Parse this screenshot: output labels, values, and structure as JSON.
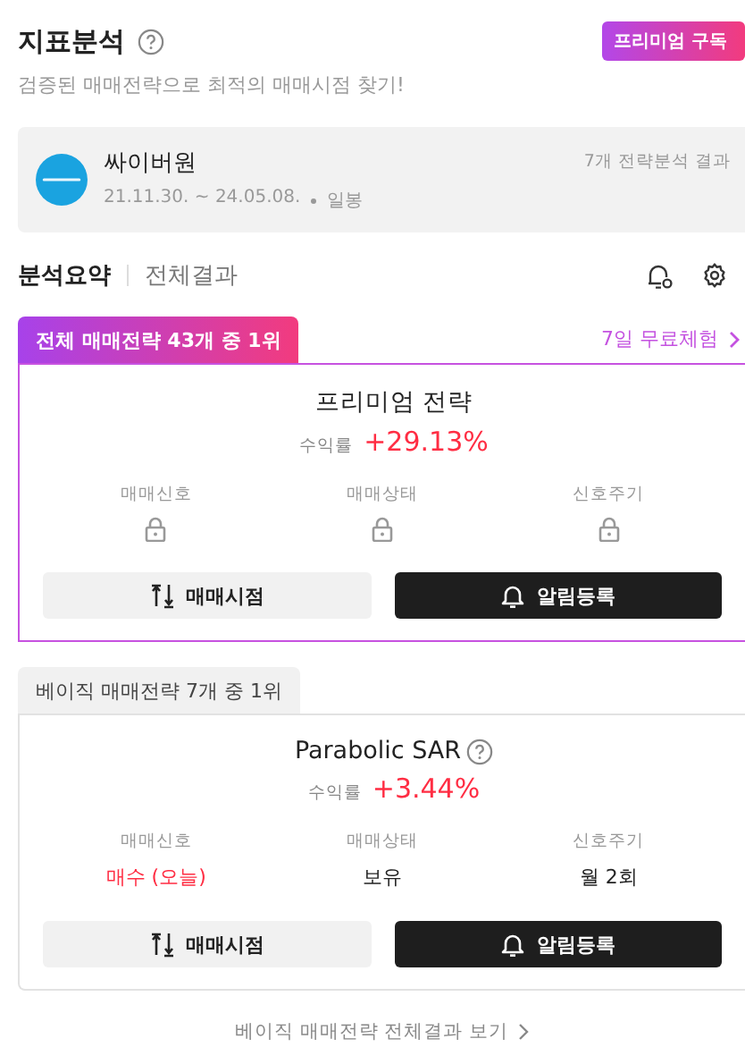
{
  "header": {
    "title": "지표분석",
    "subtitle": "검증된 매매전략으로 최적의 매매시점 찾기!",
    "premium_button": "프리미엄 구독"
  },
  "stock": {
    "name": "싸이버원",
    "period": "21.11.30. ~ 24.05.08.",
    "interval": "일봉",
    "result_count": "7개 전략분석 결과"
  },
  "tabs": [
    {
      "label": "분석요약",
      "selected": true
    },
    {
      "label": "전체결과",
      "selected": false
    }
  ],
  "strategies": [
    {
      "kind": "premium",
      "rank": "전체 매매전략 43개 중 1위",
      "trial_link": "7일 무료체험",
      "name": "프리미엄 전략",
      "help": false,
      "return_label": "수익률",
      "return_value": "+29.13%",
      "stats": [
        {
          "label": "매매신호",
          "locked": true
        },
        {
          "label": "매매상태",
          "locked": true
        },
        {
          "label": "신호주기",
          "locked": true
        }
      ],
      "buttons": [
        "매매시점",
        "알림등록"
      ]
    },
    {
      "kind": "basic",
      "rank": "베이직 매매전략 7개 중 1위",
      "name": "Parabolic SAR",
      "help": true,
      "return_label": "수익률",
      "return_value": "+3.44%",
      "stats": [
        {
          "label": "매매신호",
          "locked": false,
          "value": "매수 (오늘)",
          "color": "#ff2d43"
        },
        {
          "label": "매매상태",
          "locked": false,
          "value": "보유",
          "color": "#222222"
        },
        {
          "label": "신호주기",
          "locked": false,
          "value": "월 2회",
          "color": "#222222"
        }
      ],
      "buttons": [
        "매매시점",
        "알림등록"
      ]
    }
  ],
  "footer_link": "베이직 매매전략 전체결과 보기"
}
